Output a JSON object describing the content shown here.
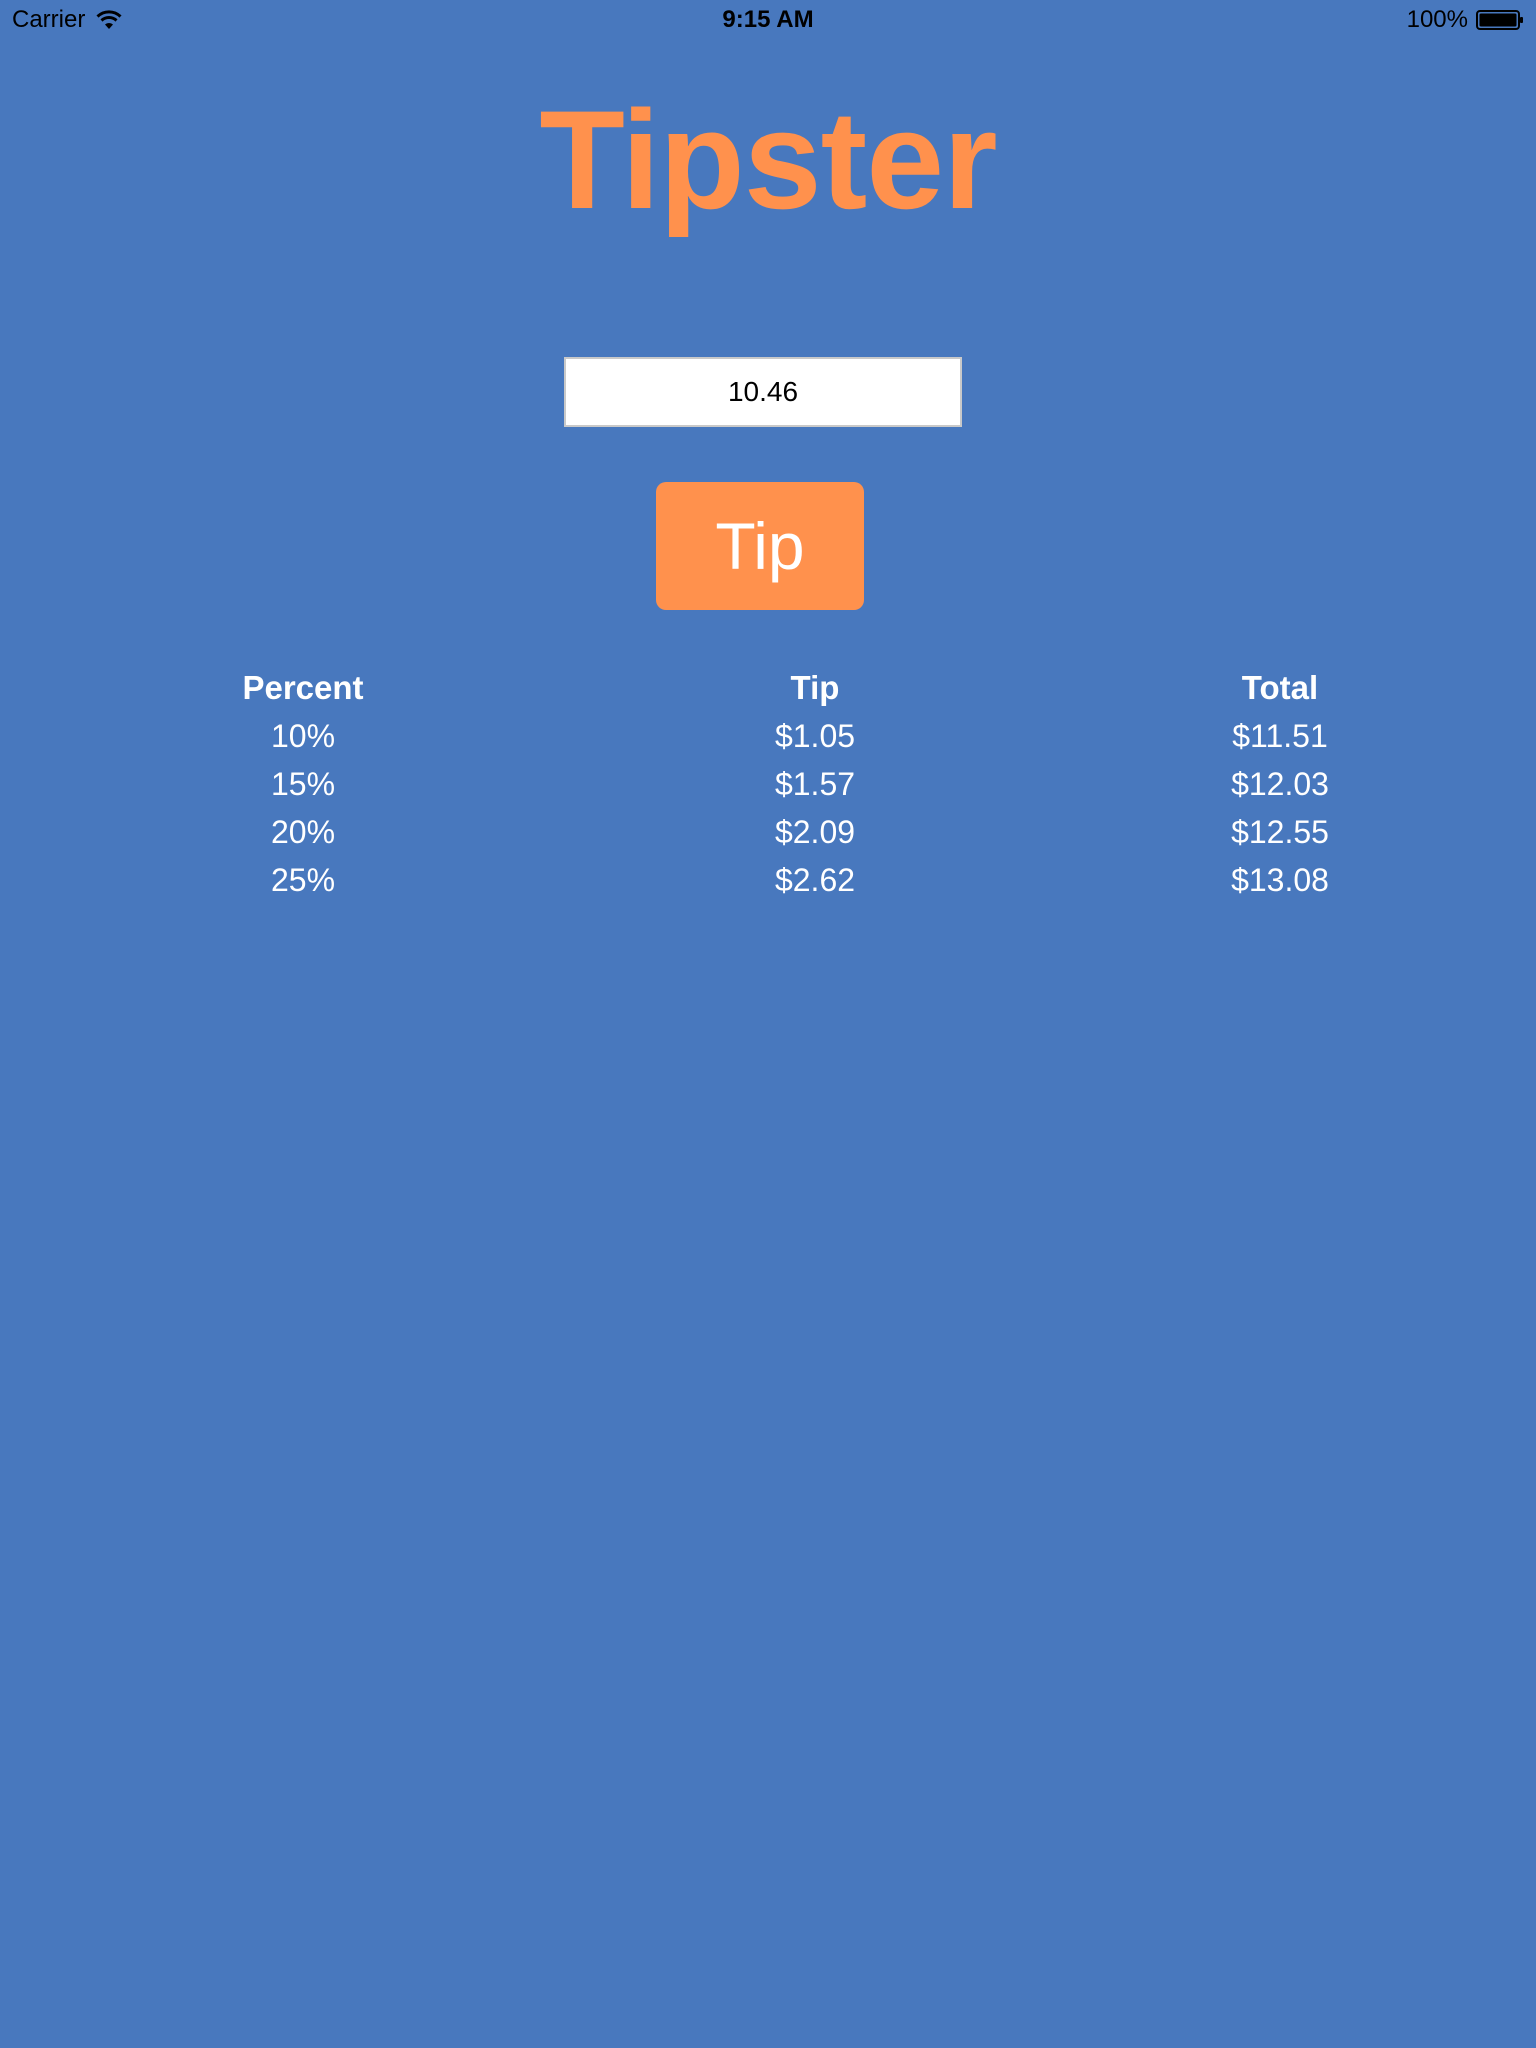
{
  "status_bar": {
    "carrier": "Carrier",
    "time": "9:15 AM",
    "battery": "100%"
  },
  "app": {
    "title": "Tipster",
    "bill_amount": "10.46",
    "tip_button_label": "Tip"
  },
  "table": {
    "headers": [
      "Percent",
      "Tip",
      "Total"
    ],
    "rows": [
      [
        "10%",
        "$1.05",
        "$11.51"
      ],
      [
        "15%",
        "$1.57",
        "$12.03"
      ],
      [
        "20%",
        "$2.09",
        "$12.55"
      ],
      [
        "25%",
        "$2.62",
        "$13.08"
      ]
    ]
  },
  "colors": {
    "background": "#4878be",
    "accent": "#ff914d",
    "text_light": "#ffffff"
  }
}
